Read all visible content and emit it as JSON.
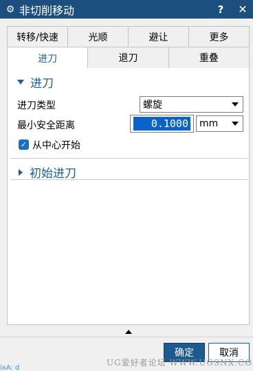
{
  "window": {
    "title": "非切削移动",
    "help_label": "?",
    "close_label": "✕",
    "icon": "gear-icon"
  },
  "tabs_top": [
    {
      "label": "转移/快速"
    },
    {
      "label": "光顺"
    },
    {
      "label": "避让"
    },
    {
      "label": "更多"
    }
  ],
  "tabs_bottom": [
    {
      "label": "进刀",
      "active": true
    },
    {
      "label": "退刀"
    },
    {
      "label": "重叠"
    }
  ],
  "section_engage": {
    "title": "进刀",
    "type_label": "进刀类型",
    "type_value": "螺旋",
    "min_dist_label": "最小安全距离",
    "min_dist_value": "0.1000",
    "unit_value": "mm",
    "from_center_label": "从中心开始",
    "from_center_checked": true
  },
  "section_initial": {
    "title": "初始进刀"
  },
  "buttons": {
    "ok": "确定",
    "cancel": "取消"
  },
  "watermark": "UG爱好者论坛 WWW.UGSNX.COM",
  "taskbar_fragment": "ixA: d",
  "colors": {
    "titlebar": "#1c4f7e",
    "accent": "#1b5e9c",
    "selection": "#0a64c8"
  }
}
